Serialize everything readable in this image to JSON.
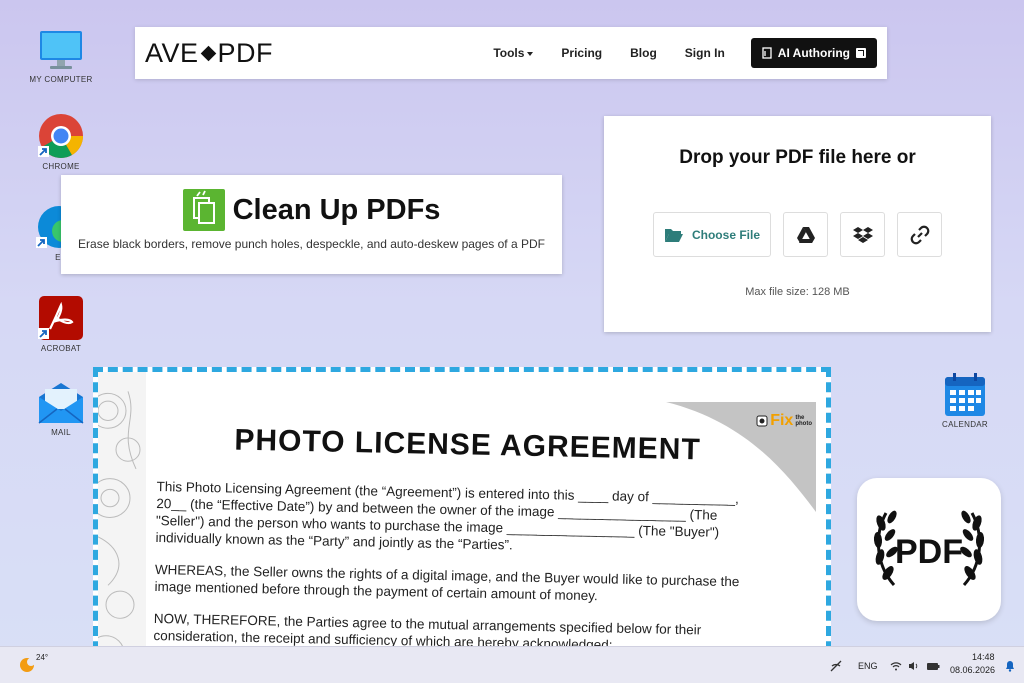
{
  "desktop": {
    "icons": [
      {
        "label": "MY COMPUTER",
        "icon": "monitor-icon"
      },
      {
        "label": "CHROME",
        "icon": "chrome-icon"
      },
      {
        "label": "ED",
        "icon": "edge-icon"
      },
      {
        "label": "ACROBAT",
        "icon": "acrobat-icon"
      },
      {
        "label": "MAIL",
        "icon": "mail-icon"
      },
      {
        "label": "CALENDAR",
        "icon": "calendar-icon"
      }
    ]
  },
  "navbar": {
    "logo_left": "AVE",
    "logo_right": "PDF",
    "links": [
      "Tools",
      "Pricing",
      "Blog",
      "Sign In"
    ],
    "ai_button": "AI Authoring"
  },
  "cleanup": {
    "title": "Clean Up PDFs",
    "subtitle": "Erase black borders, remove punch holes, despeckle, and auto-deskew pages of a PDF"
  },
  "drop": {
    "title": "Drop your PDF file here or",
    "choose_label": "Choose File",
    "buttons": [
      "google-drive-icon",
      "dropbox-icon",
      "link-icon"
    ],
    "max_size": "Max file size: 128 MB"
  },
  "document": {
    "heading": "PHOTO LICENSE AGREEMENT",
    "p1": "This Photo Licensing Agreement (the “Agreement”) is entered into this ____ day of ___________, 20__ (the “Effective Date”) by and between the owner of the image _________________ (The \"Seller\") and the person who wants to purchase the image _________________ (The \"Buyer\") individually known as the “Party” and jointly as the “Parties”.",
    "p2": "WHEREAS, the Seller owns the rights of a digital image, and the Buyer would like to purchase the image mentioned before through the payment of certain amount of money.",
    "p3": "NOW, THEREFORE, the Parties agree to the mutual arrangements specified below for their consideration, the receipt and sufficiency of which are hereby acknowledged:",
    "badge_main": "Fix",
    "badge_small1": "the",
    "badge_small2": "photo"
  },
  "pdf_tile": {
    "text": "PDF"
  },
  "taskbar": {
    "weather": "24°",
    "lang": "ENG",
    "time": "14:48",
    "date": "08.06.2026"
  },
  "colors": {
    "accent": "#2ea8e0",
    "choose_text": "#2e7d7a",
    "green": "#5bb531"
  }
}
